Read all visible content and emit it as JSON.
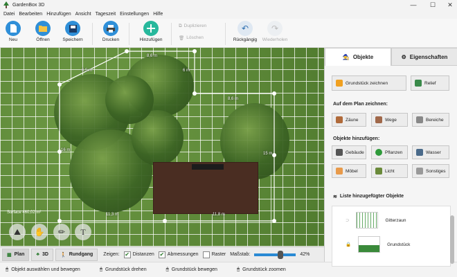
{
  "window": {
    "title": "GardenBox 3D",
    "minimize": "—",
    "maximize": "☐",
    "close": "✕"
  },
  "menu": [
    "Datei",
    "Bearbeiten",
    "Hinzufügen",
    "Ansicht",
    "Tageszeit",
    "Einstellungen",
    "Hilfe"
  ],
  "toolbar": {
    "new": "Neu",
    "open": "Öffnen",
    "save": "Speichern",
    "print": "Drucken",
    "add": "Hinzufügen",
    "duplicate": "Duplizieren",
    "delete": "Löschen",
    "undo": "Rückgängig",
    "redo": "Wiederholen"
  },
  "canvas": {
    "dims": [
      "6,5 m",
      "8,6 m",
      "6 m",
      "8,6 m",
      "16 m",
      "15 m",
      "11,3 m",
      "11,8 m"
    ],
    "surface": "Surface 460,02 m²"
  },
  "viewbar": {
    "plan": "Plan",
    "threed": "3D",
    "walk": "Rundgang",
    "show_label": "Zeigen:",
    "distances": "Distanzen",
    "dimensions": "Abmessungen",
    "grid": "Raster",
    "scale_label": "Maßstab:",
    "scale_value": "42%",
    "scale_level": 0.42
  },
  "status": [
    "Objekt auswählen und bewegen",
    "Grundstück drehen",
    "Grundstück bewegen",
    "Grundstück zoomen"
  ],
  "panel": {
    "tab_objects": "Objekte",
    "tab_properties": "Eigenschaften",
    "draw_lot": "Grundstück zeichnen",
    "relief": "Relief",
    "draw_heading": "Auf dem Plan zeichnen:",
    "fences": "Zäune",
    "paths": "Wege",
    "areas": "Bereiche",
    "add_heading": "Objekte hinzufügen:",
    "buildings": "Gebäude",
    "plants": "Pflanzen",
    "water": "Wasser",
    "furniture": "Möbel",
    "light": "Licht",
    "other": "Sonstiges",
    "list_heading": "Liste hinzugefügter Objekte",
    "list_items": [
      "Gitterzaun",
      "Grundstück"
    ]
  }
}
